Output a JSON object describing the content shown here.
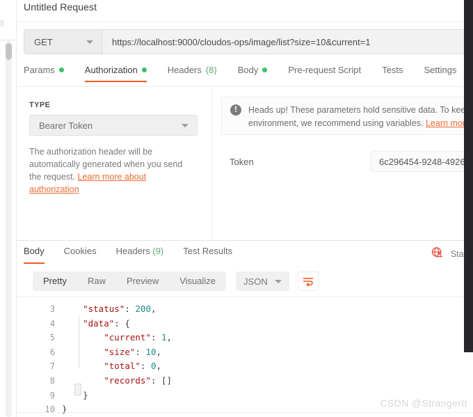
{
  "request": {
    "title": "Untitled Request",
    "method": "GET",
    "url": "https://localhost:9000/cloudos-ops/image/list?size=10&current=1",
    "tabs": [
      {
        "label": "Params",
        "dot": true,
        "count": "",
        "active": false
      },
      {
        "label": "Authorization",
        "dot": true,
        "count": "",
        "active": true
      },
      {
        "label": "Headers",
        "dot": false,
        "count": "(8)",
        "active": false
      },
      {
        "label": "Body",
        "dot": true,
        "count": "",
        "active": false
      },
      {
        "label": "Pre-request Script",
        "dot": false,
        "count": "",
        "active": false
      },
      {
        "label": "Tests",
        "dot": false,
        "count": "",
        "active": false
      },
      {
        "label": "Settings",
        "dot": false,
        "count": "",
        "active": false
      }
    ]
  },
  "authorization": {
    "type_label": "TYPE",
    "type_value": "Bearer Token",
    "note_text": "The authorization header will be automatically generated when you send the request. ",
    "note_link": "Learn more about authorization",
    "heads_up_line1": "Heads up! These parameters hold sensitive data. To keep",
    "heads_up_line2_pre": "environment, we recommend using variables. ",
    "heads_up_line2_link": "Learn mor",
    "warn_icon_glyph": "!",
    "token_label": "Token",
    "token_value": "6c296454-9248-4926"
  },
  "response": {
    "tabs": [
      {
        "label": "Body",
        "count": "",
        "active": true
      },
      {
        "label": "Cookies",
        "count": "",
        "active": false
      },
      {
        "label": "Headers",
        "count": "(9)",
        "active": false
      },
      {
        "label": "Test Results",
        "count": "",
        "active": false
      }
    ],
    "status_text": "Statu",
    "view_modes": [
      {
        "label": "Pretty",
        "active": true
      },
      {
        "label": "Raw",
        "active": false
      },
      {
        "label": "Preview",
        "active": false
      },
      {
        "label": "Visualize",
        "active": false
      }
    ],
    "format": "JSON",
    "wrap_icon": "wrap-lines-icon",
    "code_lines": [
      {
        "no": "3",
        "indent": 4,
        "segments": [
          {
            "t": "\"status\"",
            "c": "k"
          },
          {
            "t": ": ",
            "c": "p"
          },
          {
            "t": "200",
            "c": "n"
          },
          {
            "t": ",",
            "c": "p"
          }
        ]
      },
      {
        "no": "4",
        "indent": 4,
        "segments": [
          {
            "t": "\"data\"",
            "c": "k"
          },
          {
            "t": ": {",
            "c": "p"
          }
        ]
      },
      {
        "no": "5",
        "indent": 8,
        "segments": [
          {
            "t": "\"current\"",
            "c": "k"
          },
          {
            "t": ": ",
            "c": "p"
          },
          {
            "t": "1",
            "c": "n"
          },
          {
            "t": ",",
            "c": "p"
          }
        ]
      },
      {
        "no": "6",
        "indent": 8,
        "segments": [
          {
            "t": "\"size\"",
            "c": "k"
          },
          {
            "t": ": ",
            "c": "p"
          },
          {
            "t": "10",
            "c": "n"
          },
          {
            "t": ",",
            "c": "p"
          }
        ]
      },
      {
        "no": "7",
        "indent": 8,
        "segments": [
          {
            "t": "\"total\"",
            "c": "k"
          },
          {
            "t": ": ",
            "c": "p"
          },
          {
            "t": "0",
            "c": "n"
          },
          {
            "t": ",",
            "c": "p"
          }
        ]
      },
      {
        "no": "8",
        "indent": 8,
        "segments": [
          {
            "t": "\"records\"",
            "c": "k"
          },
          {
            "t": ": []",
            "c": "p"
          }
        ]
      },
      {
        "no": "9",
        "indent": 4,
        "segments": [
          {
            "t": "}",
            "c": "p"
          }
        ]
      },
      {
        "no": "10",
        "indent": 0,
        "segments": [
          {
            "t": "}",
            "c": "p"
          }
        ]
      }
    ]
  },
  "watermark": "CSDN @StrangerIt",
  "colors": {
    "accent": "#ef5b25",
    "link": "#ef6c33",
    "dot_green": "#3dbf6a",
    "count_green": "#5aab6d",
    "status_red": "#e8453c",
    "json_key": "#a31515",
    "json_number": "#1d8a8a"
  }
}
